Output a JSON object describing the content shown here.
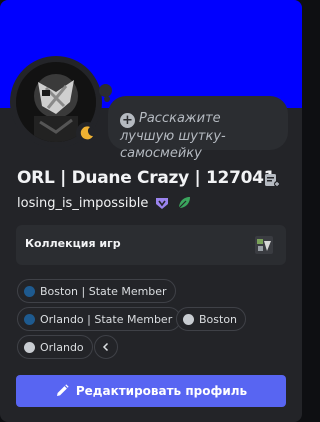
{
  "profile": {
    "display_name": "ORL | Duane Crazy | 127041",
    "username": "losing_is_impossible",
    "status_placeholder": "Расскажите лучшую шутку-самосмейку",
    "banner_color": "#0000ff",
    "status_icon": "moon-icon"
  },
  "games": {
    "label": "Коллекция игр",
    "icon": "gta-v-icon"
  },
  "roles": [
    {
      "label": "Boston | State Member",
      "color": "#1e5a8f"
    },
    {
      "label": "Orlando | State Member",
      "color": "#1e5a8f"
    },
    {
      "label": "Boston",
      "color": "#c8ccd1"
    },
    {
      "label": "Orlando",
      "color": "#c8ccd1"
    }
  ],
  "edit_button": {
    "label": "Редактировать профиль"
  },
  "colors": {
    "accent": "#5865f2",
    "card_bg": "#232428"
  }
}
